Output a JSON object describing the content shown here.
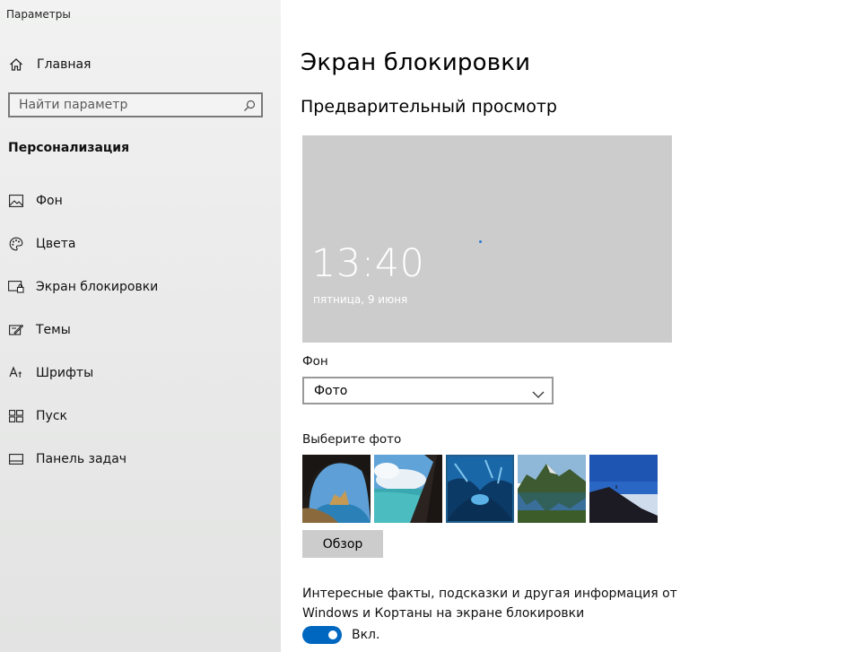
{
  "window": {
    "title": "Параметры"
  },
  "sidebar": {
    "home_label": "Главная",
    "search_placeholder": "Найти параметр",
    "section_heading": "Персонализация",
    "items": [
      {
        "label": "Фон",
        "icon": "picture-icon"
      },
      {
        "label": "Цвета",
        "icon": "palette-icon"
      },
      {
        "label": "Экран блокировки",
        "icon": "lock-screen-icon"
      },
      {
        "label": "Темы",
        "icon": "themes-icon"
      },
      {
        "label": "Шрифты",
        "icon": "fonts-icon"
      },
      {
        "label": "Пуск",
        "icon": "start-icon"
      },
      {
        "label": "Панель задач",
        "icon": "taskbar-icon"
      }
    ]
  },
  "main": {
    "title": "Экран блокировки",
    "preview_heading": "Предварительный просмотр",
    "preview": {
      "time": "13:40",
      "date": "пятница, 9 июня"
    },
    "background_label": "Фон",
    "background_value": "Фото",
    "choose_photo_label": "Выберите фото",
    "browse_label": "Обзор",
    "facts_text": "Интересные факты, подсказки и другая информация от Windows и Кортаны на экране блокировки",
    "toggle_state_label": "Вкл."
  },
  "colors": {
    "accent": "#0067c0",
    "sidebar_bg": "#ececec",
    "preview_bg": "#cccccc"
  }
}
